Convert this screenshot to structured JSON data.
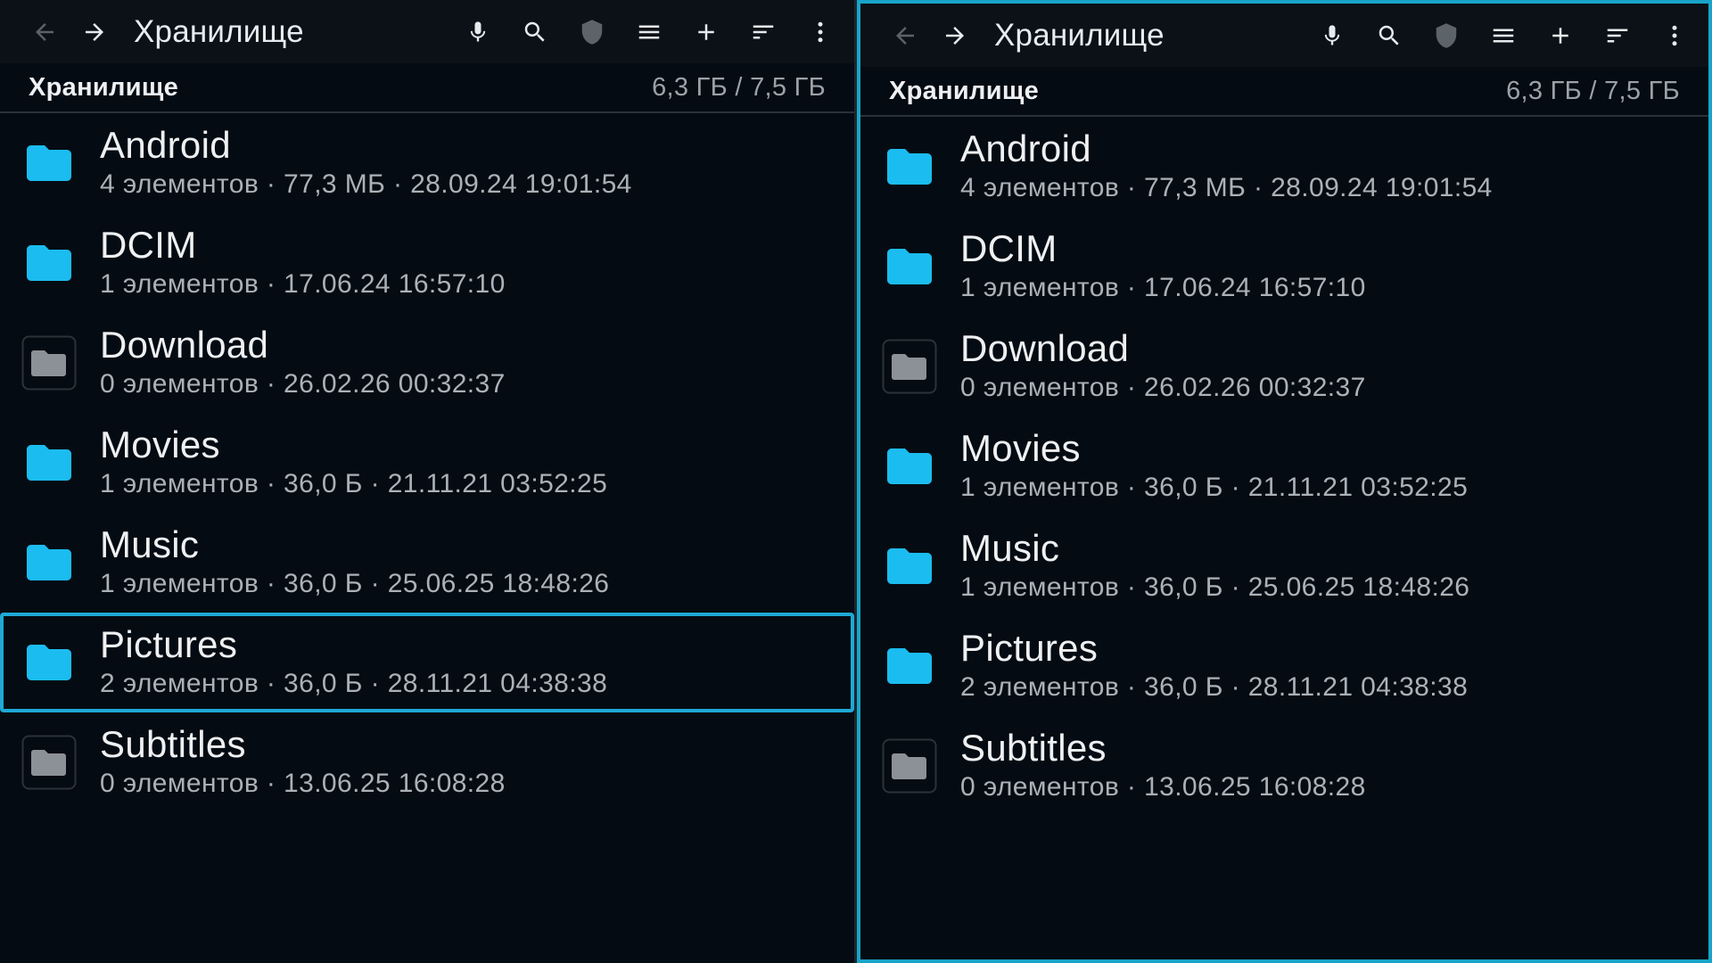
{
  "colors": {
    "accent": "#1ea9d6",
    "folder_filled": "#1bbcf0",
    "folder_empty": "#8b9196",
    "background": "#050b12",
    "toolbar": "#0b1117"
  },
  "panes": [
    {
      "toolbar": {
        "title": "Хранилище",
        "icons": [
          "arrow-back-icon",
          "arrow-forward-icon",
          "microphone-icon",
          "search-icon",
          "shield-icon",
          "list-view-icon",
          "add-icon",
          "sort-icon",
          "more-vert-icon"
        ]
      },
      "path": {
        "title": "Хранилище",
        "space": "6,3 ГБ / 7,5 ГБ"
      },
      "items": [
        {
          "name": "Android",
          "meta": "4 элементов · 77,3 МБ · 28.09.24 19:01:54",
          "icon": "folder-filled-icon"
        },
        {
          "name": "DCIM",
          "meta": "1 элементов · 17.06.24 16:57:10",
          "icon": "folder-filled-icon"
        },
        {
          "name": "Download",
          "meta": "0 элементов · 26.02.26 00:32:37",
          "icon": "folder-empty-icon"
        },
        {
          "name": "Movies",
          "meta": "1 элементов · 36,0 Б · 21.11.21 03:52:25",
          "icon": "folder-filled-icon"
        },
        {
          "name": "Music",
          "meta": "1 элементов · 36,0 Б · 25.06.25 18:48:26",
          "icon": "folder-filled-icon"
        },
        {
          "name": "Pictures",
          "meta": "2 элементов · 36,0 Б · 28.11.21 04:38:38",
          "icon": "folder-filled-icon",
          "selected": true
        },
        {
          "name": "Subtitles",
          "meta": "0 элементов · 13.06.25 16:08:28",
          "icon": "folder-empty-icon"
        }
      ]
    },
    {
      "toolbar": {
        "title": "Хранилище",
        "icons": [
          "arrow-back-icon",
          "arrow-forward-icon",
          "microphone-icon",
          "search-icon",
          "shield-icon",
          "list-view-icon",
          "add-icon",
          "sort-icon",
          "more-vert-icon"
        ]
      },
      "path": {
        "title": "Хранилище",
        "space": "6,3 ГБ / 7,5 ГБ"
      },
      "items": [
        {
          "name": "Android",
          "meta": "4 элементов · 77,3 МБ · 28.09.24 19:01:54",
          "icon": "folder-filled-icon"
        },
        {
          "name": "DCIM",
          "meta": "1 элементов · 17.06.24 16:57:10",
          "icon": "folder-filled-icon"
        },
        {
          "name": "Download",
          "meta": "0 элементов · 26.02.26 00:32:37",
          "icon": "folder-empty-icon"
        },
        {
          "name": "Movies",
          "meta": "1 элементов · 36,0 Б · 21.11.21 03:52:25",
          "icon": "folder-filled-icon"
        },
        {
          "name": "Music",
          "meta": "1 элементов · 36,0 Б · 25.06.25 18:48:26",
          "icon": "folder-filled-icon"
        },
        {
          "name": "Pictures",
          "meta": "2 элементов · 36,0 Б · 28.11.21 04:38:38",
          "icon": "folder-filled-icon"
        },
        {
          "name": "Subtitles",
          "meta": "0 элементов · 13.06.25 16:08:28",
          "icon": "folder-empty-icon"
        }
      ]
    }
  ]
}
